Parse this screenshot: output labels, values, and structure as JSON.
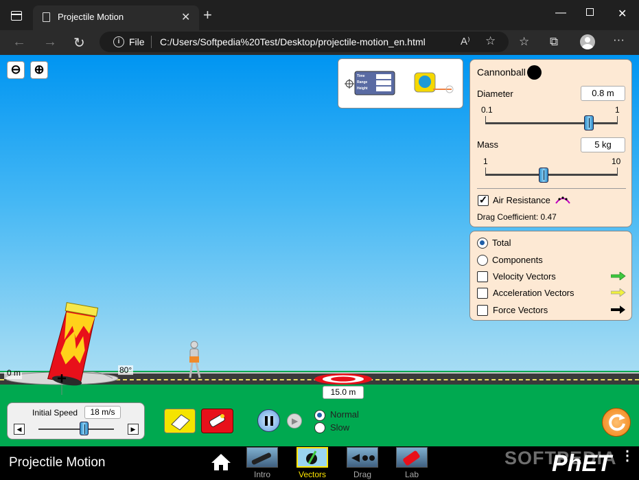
{
  "browser": {
    "tab_title": "Projectile Motion",
    "file_label": "File",
    "url": "C:/Users/Softpedia%20Test/Desktop/projectile-motion_en.html"
  },
  "tools": {
    "stopwatch_labels": [
      "Time",
      "Range",
      "Height"
    ]
  },
  "settings_panel": {
    "projectile_name": "Cannonball",
    "diameter_label": "Diameter",
    "diameter_value": "0.8 m",
    "diameter_min": "0.1",
    "diameter_max": "1",
    "diameter_fraction": 0.78,
    "mass_label": "Mass",
    "mass_value": "5 kg",
    "mass_min": "1",
    "mass_max": "10",
    "mass_fraction": 0.44,
    "air_resistance_label": "Air Resistance",
    "air_resistance_checked": true,
    "drag_label": "Drag Coefficient: 0.47"
  },
  "vectors_panel": {
    "total_label": "Total",
    "components_label": "Components",
    "velocity_label": "Velocity Vectors",
    "acceleration_label": "Acceleration Vectors",
    "force_label": "Force Vectors",
    "velocity_color": "#3ec93e",
    "acceleration_color": "#f0f03c",
    "force_color": "#000000"
  },
  "scene": {
    "height_label": "0 m",
    "angle_label": "80°",
    "target_distance": "15.0 m"
  },
  "launch": {
    "speed_label": "Initial Speed",
    "speed_value": "18 m/s",
    "speed_fraction": 0.6
  },
  "playback": {
    "normal_label": "Normal",
    "slow_label": "Slow",
    "selected": "Normal"
  },
  "navbar": {
    "sim_title": "Projectile Motion",
    "screens": [
      "Intro",
      "Vectors",
      "Drag",
      "Lab"
    ],
    "active_screen": "Vectors",
    "brand": "PhET",
    "watermark": "SOFTPEDIA"
  }
}
